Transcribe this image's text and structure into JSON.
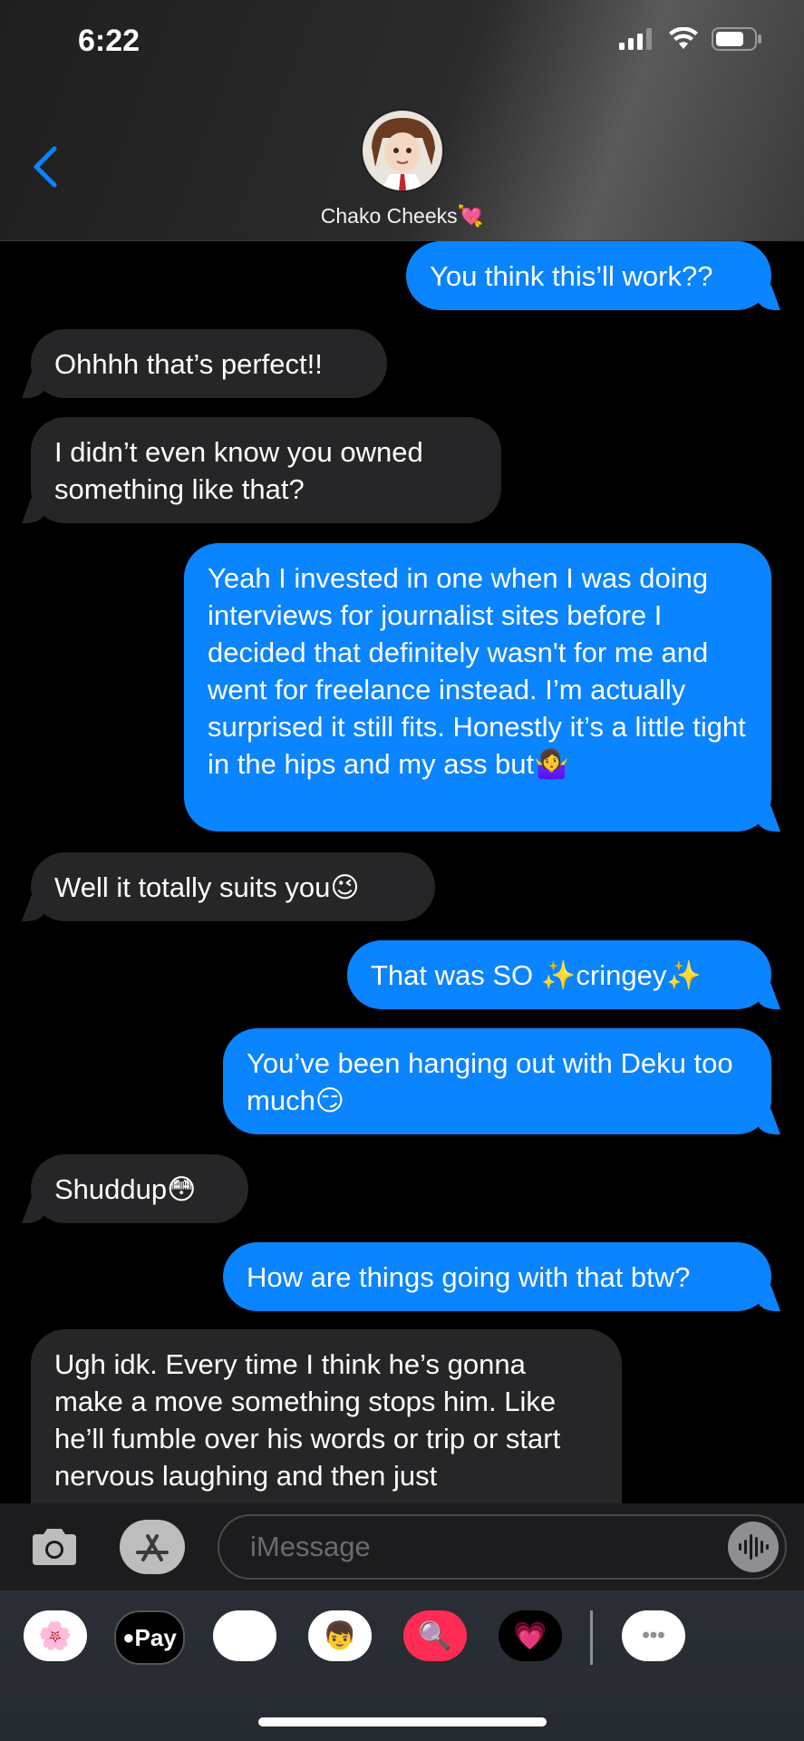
{
  "status_bar": {
    "time": "6:22"
  },
  "header": {
    "contact_name": "Chako Cheeks💘"
  },
  "messages": [
    {
      "side": "out",
      "text": "You think this’ll work??"
    },
    {
      "side": "in",
      "text": "Ohhhh that’s perfect!!"
    },
    {
      "side": "in",
      "text": "I didn’t even know you owned something like that?"
    },
    {
      "side": "out",
      "text": "Yeah I invested in one when I was doing interviews for journalist sites before I decided that definitely wasn't for me and went for freelance instead. I’m actually surprised it still fits. Honestly it’s a little tight in the hips and my ass but🤷‍♀️"
    },
    {
      "side": "in",
      "text": "Well it totally suits you😉"
    },
    {
      "side": "out",
      "text": "That was SO ✨cringey✨"
    },
    {
      "side": "out",
      "text": "You’ve been hanging out with Deku too much😏"
    },
    {
      "side": "in",
      "text": "Shuddup😳"
    },
    {
      "side": "out",
      "text": "How are things going with that btw?"
    },
    {
      "side": "in",
      "text": "Ugh idk. Every time I think he’s gonna make a move something stops him. Like he’ll fumble over his words or trip or start nervous laughing and then just"
    }
  ],
  "input": {
    "placeholder": "iMessage"
  },
  "app_drawer": {
    "items": [
      {
        "name": "photos-app-icon",
        "glyph": "🌸",
        "bg": "#ffffff"
      },
      {
        "name": "apple-pay-app-icon",
        "glyph": "Pay",
        "bg": "#000000"
      },
      {
        "name": "animoji-app-icon",
        "glyph": "🐵",
        "bg": "#ffffff"
      },
      {
        "name": "memoji-app-icon",
        "glyph": "👦",
        "bg": "#ffffff"
      },
      {
        "name": "image-search-app-icon",
        "glyph": "🔍",
        "bg": "#ff2d55"
      },
      {
        "name": "digital-touch-app-icon",
        "glyph": "💗",
        "bg": "#000000"
      },
      {
        "name": "more-apps-icon",
        "glyph": "•••",
        "bg": "#ffffff"
      }
    ]
  },
  "colors": {
    "outgoing": "#0a84ff",
    "incoming": "#262628",
    "accent": "#0a84ff"
  }
}
